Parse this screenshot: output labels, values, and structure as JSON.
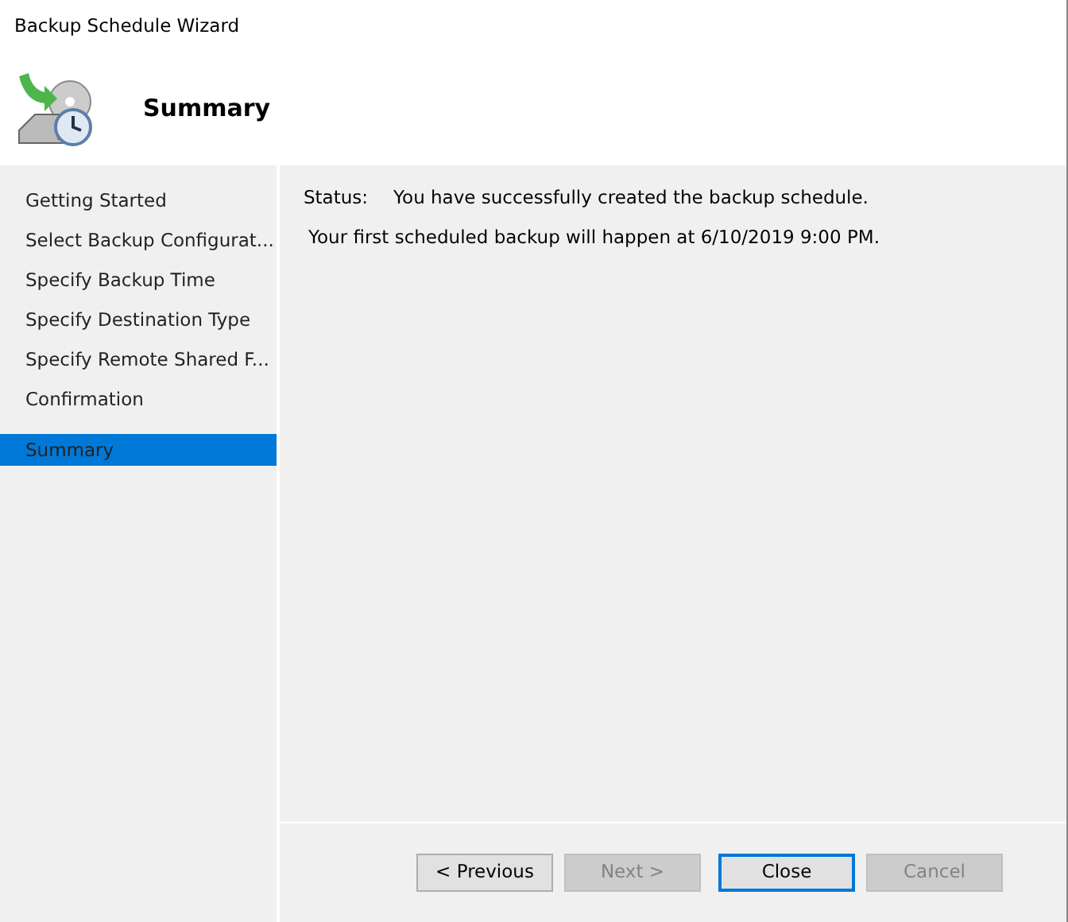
{
  "window": {
    "title": "Backup Schedule Wizard"
  },
  "header": {
    "title": "Summary"
  },
  "steps": [
    {
      "label": "Getting Started",
      "selected": false
    },
    {
      "label": "Select Backup Configurat...",
      "selected": false
    },
    {
      "label": "Specify Backup Time",
      "selected": false
    },
    {
      "label": "Specify Destination Type",
      "selected": false
    },
    {
      "label": "Specify Remote Shared F...",
      "selected": false
    },
    {
      "label": "Confirmation",
      "selected": false
    },
    {
      "label": "Summary",
      "selected": true
    }
  ],
  "status": {
    "label": "Status:",
    "value": "You have successfully created the backup schedule."
  },
  "message": "Your first scheduled backup will happen at 6/10/2019 9:00 PM.",
  "buttons": [
    {
      "label": "< Previous",
      "disabled": false,
      "focused": false
    },
    {
      "label": "Next >",
      "disabled": true,
      "focused": false
    },
    {
      "label": "Close",
      "disabled": false,
      "focused": true
    },
    {
      "label": "Cancel",
      "disabled": true,
      "focused": false
    }
  ]
}
